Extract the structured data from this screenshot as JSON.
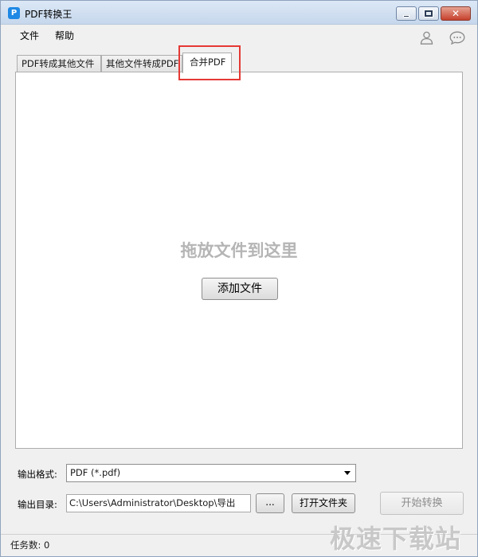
{
  "window": {
    "title": "PDF转换王",
    "logo_glyph": "P",
    "close_glyph": "✕"
  },
  "menu": {
    "items": [
      "文件",
      "帮助"
    ]
  },
  "tabs": [
    {
      "label": "PDF转成其他文件",
      "active": false
    },
    {
      "label": "其他文件转成PDF",
      "active": false
    },
    {
      "label": "合并PDF",
      "active": true
    }
  ],
  "panel": {
    "drop_hint": "拖放文件到这里",
    "add_button": "添加文件"
  },
  "form": {
    "format_label": "输出格式:",
    "format_value": "PDF (*.pdf)",
    "dir_label": "输出目录:",
    "dir_value": "C:\\Users\\Administrator\\Desktop\\导出",
    "browse_button": "...",
    "open_folder_button": "打开文件夹",
    "start_button": "开始转换"
  },
  "status": {
    "task_count": "任务数: 0"
  },
  "watermark": "极速下载站",
  "colors": {
    "accent": "#1e88e5",
    "highlight": "#e53935"
  },
  "icons": {
    "user": "user-icon",
    "chat": "chat-bubble-icon"
  }
}
